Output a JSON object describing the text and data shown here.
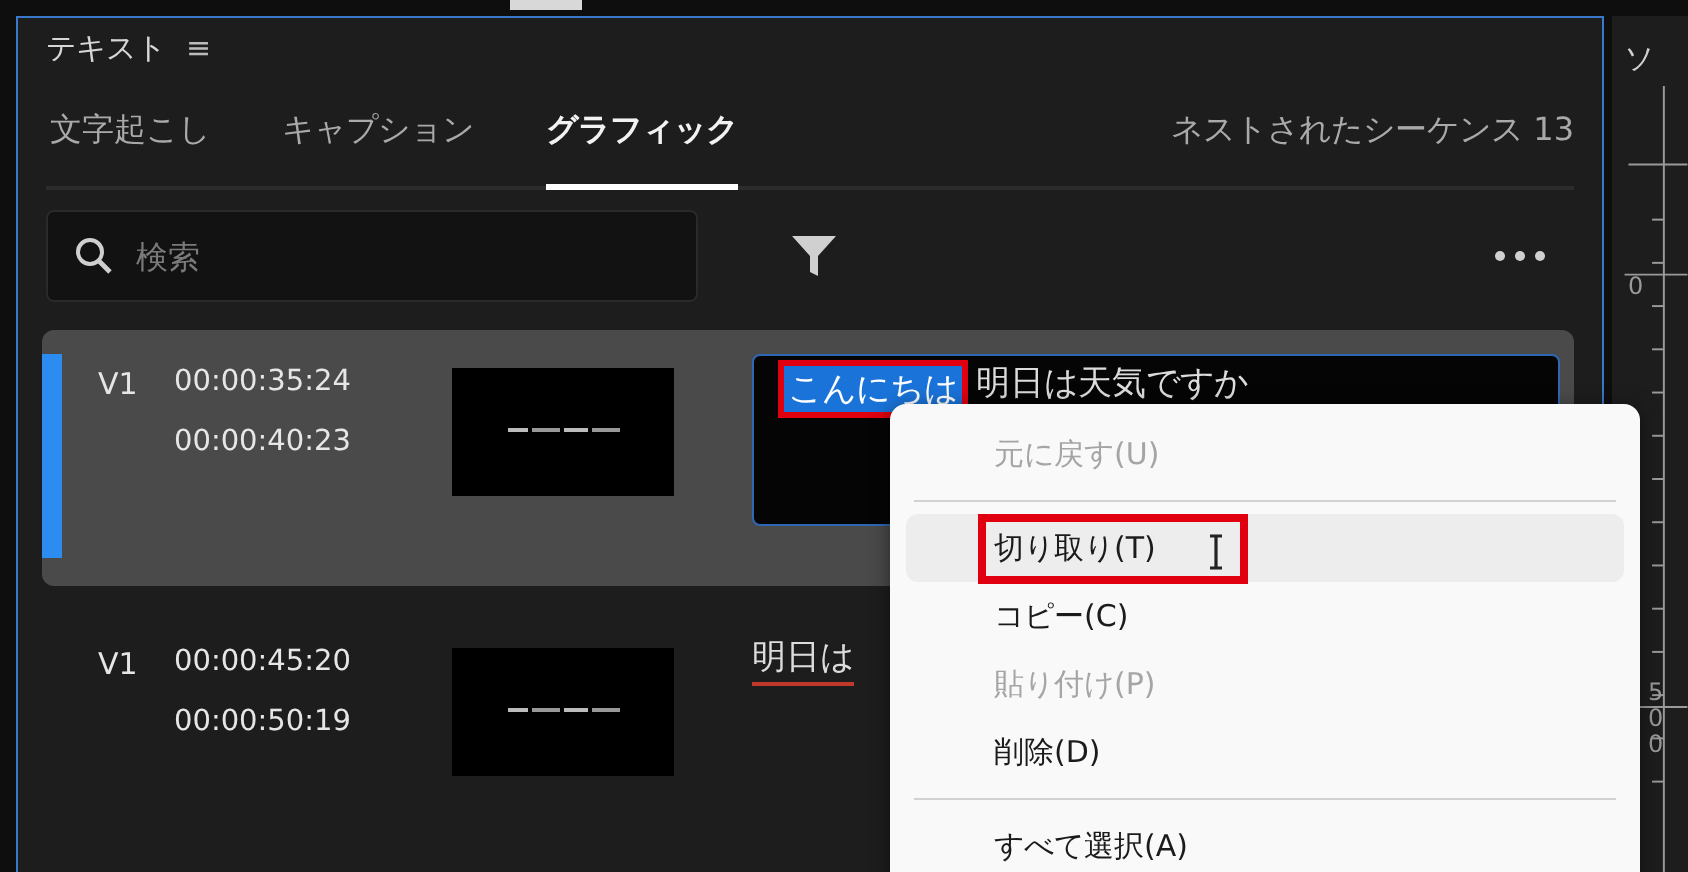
{
  "panel": {
    "title": "テキスト",
    "menu_glyph": "≡"
  },
  "tabs": [
    {
      "label": "文字起こし",
      "selected": false
    },
    {
      "label": "キャプション",
      "selected": false
    },
    {
      "label": "グラフィック",
      "selected": true
    },
    {
      "label": "ネストされたシーケンス 13",
      "selected": false
    }
  ],
  "search": {
    "placeholder": "検索"
  },
  "rows": [
    {
      "kind": "editor",
      "track": "V1",
      "in": "00:00:35:24",
      "out": "00:00:40:23",
      "selected": true,
      "selected_text": "こんにちは",
      "text": "明日は天気ですか",
      "annotated": true
    },
    {
      "kind": "text",
      "track": "V1",
      "in": "00:00:45:20",
      "out": "00:00:50:19",
      "selected": false,
      "text": "明日は",
      "spell_error": true
    }
  ],
  "context_menu": {
    "items": [
      {
        "kind": "item",
        "label": "元に戻す(U)",
        "disabled": true,
        "hovered": false,
        "annotated": false
      },
      {
        "kind": "divider"
      },
      {
        "kind": "item",
        "label": "切り取り(T)",
        "disabled": false,
        "hovered": true,
        "annotated": true
      },
      {
        "kind": "item",
        "label": "コピー(C)",
        "disabled": false,
        "hovered": false,
        "annotated": false
      },
      {
        "kind": "item",
        "label": "貼り付け(P)",
        "disabled": true,
        "hovered": false,
        "annotated": false
      },
      {
        "kind": "item",
        "label": "削除(D)",
        "disabled": false,
        "hovered": false,
        "annotated": false
      },
      {
        "kind": "divider"
      },
      {
        "kind": "item",
        "label": "すべて選択(A)",
        "disabled": false,
        "hovered": false,
        "annotated": false
      }
    ]
  },
  "side_panel": {
    "title": "ソ",
    "ruler_labels": [
      "0",
      "500"
    ]
  }
}
